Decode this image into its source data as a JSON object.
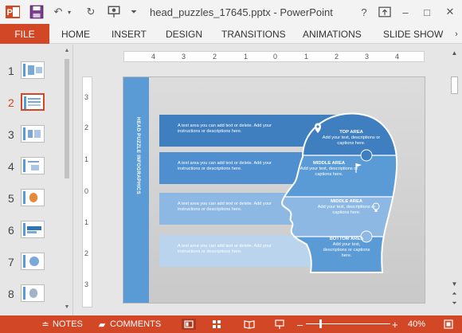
{
  "window": {
    "title": "head_puzzles_17645.pptx - PowerPoint",
    "app_icon_letter": "P",
    "help_label": "?",
    "minimize_label": "–",
    "restore_label": "□",
    "close_label": "✕"
  },
  "quick_access": {
    "save_icon": "save-icon",
    "undo_icon": "undo-icon",
    "redo_icon": "redo-icon",
    "present_icon": "present-from-beginning-icon",
    "customize_icon": "customize-icon"
  },
  "ribbon": {
    "file_label": "FILE",
    "tabs": [
      "HOME",
      "INSERT",
      "DESIGN",
      "TRANSITIONS",
      "ANIMATIONS",
      "SLIDE SHOW"
    ],
    "more_label": "›"
  },
  "thumbnails": {
    "numbers": [
      "1",
      "2",
      "3",
      "4",
      "5",
      "6",
      "7",
      "8"
    ],
    "active_index": 1
  },
  "rulers": {
    "horizontal": [
      "4",
      "3",
      "2",
      "1",
      "0",
      "1",
      "2",
      "3",
      "4"
    ],
    "vertical": [
      "3",
      "2",
      "1",
      "0",
      "1",
      "2",
      "3"
    ]
  },
  "slide": {
    "side_title": "HEAD PUZZLE INFOGRAPHICS",
    "text_bars": [
      "A text area you can add text or delete. Add your instructions or descriptions here.",
      "A text area you can add text or delete. Add your instructions or descriptions here.",
      "A text area you can add text or delete. Add your instructions or descriptions here.",
      "A text area you can add text or delete. Add your instructions or descriptions here."
    ],
    "areas": [
      {
        "title": "TOP AREA",
        "body": "Add your text, descriptions or captions here."
      },
      {
        "title": "MIDDLE AREA",
        "body": "Add your text, descriptions or captions here."
      },
      {
        "title": "MIDDLE AREA",
        "body": "Add your text, descriptions or captions here."
      },
      {
        "title": "BOTTOM AREA",
        "body": "Add your text, descriptions or captions here."
      }
    ],
    "colors": {
      "dark": "#3f7fc0",
      "mid": "#5b9bd5",
      "light": "#8db8e3",
      "lightest": "#bad4ee"
    }
  },
  "status": {
    "notes_label": "NOTES",
    "comments_label": "COMMENTS",
    "zoom_label": "40%",
    "zoom_out": "–",
    "zoom_in": "+"
  }
}
